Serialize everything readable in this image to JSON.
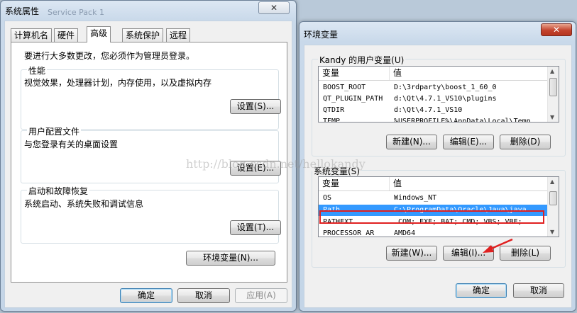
{
  "system_props": {
    "title": "系统属性",
    "bg_title_text": "Service Pack 1",
    "close_glyph": "✕",
    "tabs": [
      "计算机名",
      "硬件",
      "高级",
      "系统保护",
      "远程"
    ],
    "active_tab": "高级",
    "admin_note": "要进行大多数更改，您必须作为管理员登录。",
    "performance": {
      "title": "性能",
      "desc": "视觉效果，处理器计划，内存使用，以及虚拟内存",
      "button": "设置(S)..."
    },
    "user_profile": {
      "title": "用户配置文件",
      "desc": "与您登录有关的桌面设置",
      "button": "设置(E)..."
    },
    "startup": {
      "title": "启动和故障恢复",
      "desc": "系统启动、系统失败和调试信息",
      "button": "设置(T)..."
    },
    "env_button": "环境变量(N)...",
    "ok": "确定",
    "cancel": "取消",
    "apply": "应用(A)"
  },
  "env_vars": {
    "title": "环境变量",
    "close_glyph": "✕",
    "user_section_label": "Kandy 的用户变量(U)",
    "system_section_label": "系统变量(S)",
    "col_var": "变量",
    "col_val": "值",
    "user_vars": [
      {
        "name": "BOOST_ROOT",
        "value": "D:\\3rdparty\\boost_1_60_0"
      },
      {
        "name": "QT_PLUGIN_PATH",
        "value": "d:\\Qt\\4.7.1_VS10\\plugins"
      },
      {
        "name": "QTDIR",
        "value": "d:\\Qt\\4.7.1_VS10"
      },
      {
        "name": "TEMP",
        "value": "%USERPROFILE%\\AppData\\Local\\Temp"
      }
    ],
    "system_vars": [
      {
        "name": "OS",
        "value": "Windows_NT"
      },
      {
        "name": "Path",
        "value": "C:\\ProgramData\\Oracle\\Java\\java..."
      },
      {
        "name": "PATHEXT",
        "value": ".COM;.EXE;.BAT;.CMD;.VBS;.VBE;..."
      },
      {
        "name": "PROCESSOR_AR",
        "value": "AMD64"
      }
    ],
    "selected_system_var": "Path",
    "user_buttons": {
      "new": "新建(N)...",
      "edit": "编辑(E)...",
      "delete": "删除(D)"
    },
    "system_buttons": {
      "new": "新建(W)...",
      "edit": "编辑(I)...",
      "delete": "删除(L)"
    },
    "ok": "确定",
    "cancel": "取消"
  },
  "watermark": "http://blog.csdn.net/hellokandy",
  "annotation_color": "#e02020"
}
